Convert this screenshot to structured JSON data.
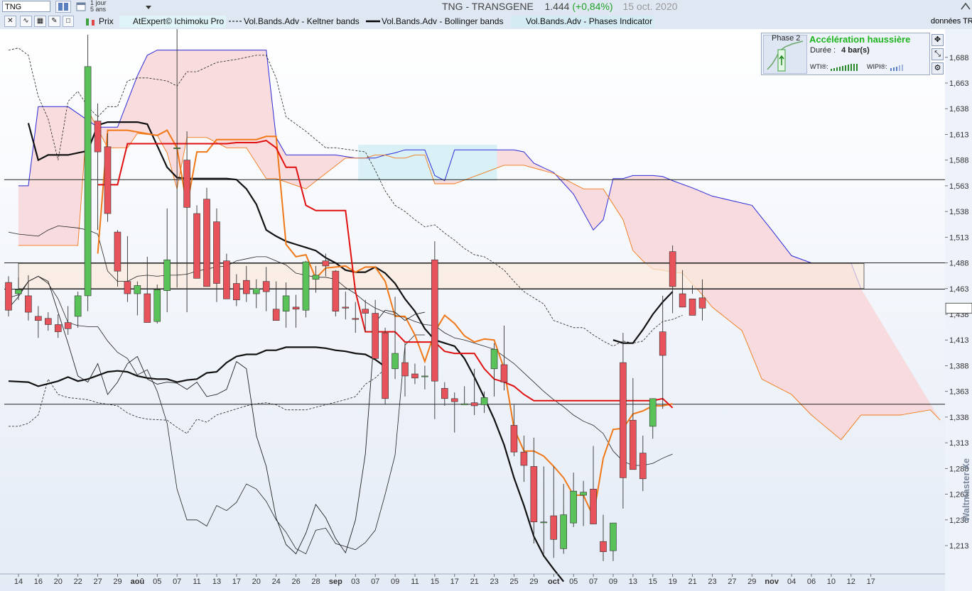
{
  "header": {
    "symbol": "TNG",
    "period_line1": "1 jour",
    "period_line2": "5 ans",
    "title_name": "TNG - TRANSGENE",
    "title_price": "1.444",
    "title_change": "(+0,84%)",
    "title_date": "15 oct. 2020",
    "donnees": "données TR"
  },
  "legend": {
    "prix": "Prix",
    "ichimoku": "AtExpert© Ichimoku Pro",
    "keltner": "Vol.Bands.Adv - Keltner bands",
    "bollinger": "Vol.Bands.Adv - Bollinger bands",
    "phases": "Vol.Bands.Adv - Phases Indicator"
  },
  "phase_panel": {
    "phase": "Phase 2",
    "title": "Accélération haussière",
    "duree_label": "Durée :",
    "duree_value": "4 bar(s)",
    "wti": "WTI®:",
    "wipi": "WIPI®:"
  },
  "brand": "Waltmaster Xe",
  "colors": {
    "bull": "#59c359",
    "bear": "#e8525a",
    "kijun": "#e01010",
    "tenkan": "#f07818",
    "cloud_bear": "#f8d6d8",
    "cloud_bull": "#d8f0f6",
    "span_line": "#2a2ad8"
  },
  "chart_data": {
    "type": "candlestick",
    "ylim": [
      1.19,
      1.72
    ],
    "yticks": [
      "1,688",
      "1,663",
      "1,638",
      "1,613",
      "1,588",
      "1,563",
      "1,538",
      "1,513",
      "1,488",
      "1,463",
      "1,438",
      "1,413",
      "1,388",
      "1,363",
      "1,338",
      "1,313",
      "1,288",
      "1,263",
      "1,238",
      "1,213"
    ],
    "x_labels": [
      "14",
      "16",
      "20",
      "22",
      "27",
      "29",
      "aoû",
      "05",
      "07",
      "11",
      "13",
      "17",
      "20",
      "24",
      "26",
      "28",
      "sep",
      "03",
      "07",
      "09",
      "11",
      "15",
      "17",
      "21",
      "23",
      "25",
      "29",
      "oct",
      "05",
      "07",
      "09",
      "13",
      "15",
      "19",
      "21",
      "23",
      "27",
      "29",
      "nov",
      "04",
      "06",
      "10",
      "12",
      "17"
    ],
    "current_price": 1.444,
    "horizontal_lines": [
      1.569,
      1.488,
      1.4625,
      1.3505
    ],
    "candles": [
      [
        1.469,
        1.475,
        1.436,
        1.442
      ],
      [
        1.458,
        1.474,
        1.452,
        1.462
      ],
      [
        1.456,
        1.476,
        1.432,
        1.44
      ],
      [
        1.436,
        1.446,
        1.415,
        1.432
      ],
      [
        1.434,
        1.44,
        1.422,
        1.428
      ],
      [
        1.428,
        1.438,
        1.415,
        1.421
      ],
      [
        1.43,
        1.446,
        1.418,
        1.424
      ],
      [
        1.436,
        1.46,
        1.425,
        1.456
      ],
      [
        1.456,
        1.71,
        1.441,
        1.679
      ],
      [
        1.626,
        1.643,
        1.52,
        1.596
      ],
      [
        1.601,
        1.614,
        1.528,
        1.536
      ],
      [
        1.518,
        1.52,
        1.465,
        1.48
      ],
      [
        1.47,
        1.514,
        1.45,
        1.458
      ],
      [
        1.458,
        1.47,
        1.437,
        1.466
      ],
      [
        1.458,
        1.494,
        1.437,
        1.43
      ],
      [
        1.431,
        1.467,
        1.429,
        1.462
      ],
      [
        1.461,
        1.541,
        1.44,
        1.491
      ],
      [
        1.599,
        1.749,
        1.464,
        1.6
      ],
      [
        1.588,
        1.616,
        1.44,
        1.542
      ],
      [
        1.536,
        1.544,
        1.478,
        1.473
      ],
      [
        1.55,
        1.561,
        1.508,
        1.465
      ],
      [
        1.528,
        1.541,
        1.45,
        1.468
      ],
      [
        1.49,
        1.497,
        1.455,
        1.453
      ],
      [
        1.468,
        1.477,
        1.446,
        1.452
      ],
      [
        1.471,
        1.485,
        1.45,
        1.458
      ],
      [
        1.458,
        1.472,
        1.444,
        1.463
      ],
      [
        1.47,
        1.484,
        1.441,
        1.46
      ],
      [
        1.443,
        1.47,
        1.432,
        1.432
      ],
      [
        1.441,
        1.469,
        1.425,
        1.456
      ],
      [
        1.445,
        1.457,
        1.425,
        1.443
      ],
      [
        1.442,
        1.49,
        1.435,
        1.489
      ],
      [
        1.472,
        1.485,
        1.459,
        1.476
      ],
      [
        1.49,
        1.497,
        1.475,
        1.485
      ],
      [
        1.48,
        1.481,
        1.436,
        1.441
      ],
      [
        1.445,
        1.46,
        1.433,
        1.444
      ],
      [
        1.434,
        1.45,
        1.42,
        1.433
      ],
      [
        1.443,
        1.452,
        1.421,
        1.439
      ],
      [
        1.439,
        1.452,
        1.405,
        1.395
      ],
      [
        1.42,
        1.425,
        1.35,
        1.356
      ],
      [
        1.385,
        1.455,
        1.375,
        1.4
      ],
      [
        1.391,
        1.41,
        1.358,
        1.378
      ],
      [
        1.38,
        1.39,
        1.37,
        1.376
      ],
      [
        1.378,
        1.388,
        1.365,
        1.378
      ],
      [
        1.491,
        1.509,
        1.336,
        1.373
      ],
      [
        1.366,
        1.372,
        1.349,
        1.356
      ],
      [
        1.356,
        1.362,
        1.323,
        1.353
      ],
      [
        1.35,
        1.368,
        1.35,
        1.351
      ],
      [
        1.352,
        1.385,
        1.34,
        1.349
      ],
      [
        1.35,
        1.363,
        1.342,
        1.357
      ],
      [
        1.385,
        1.41,
        1.358,
        1.404
      ],
      [
        1.389,
        1.427,
        1.364,
        1.372
      ],
      [
        1.33,
        1.35,
        1.3,
        1.304
      ],
      [
        1.304,
        1.32,
        1.275,
        1.291
      ],
      [
        1.29,
        1.318,
        1.215,
        1.236
      ],
      [
        1.236,
        1.29,
        1.205,
        1.236
      ],
      [
        1.242,
        1.29,
        1.201,
        1.219
      ],
      [
        1.21,
        1.273,
        1.205,
        1.243
      ],
      [
        1.235,
        1.284,
        1.231,
        1.266
      ],
      [
        1.262,
        1.276,
        1.232,
        1.265
      ],
      [
        1.268,
        1.31,
        1.255,
        1.234
      ],
      [
        1.217,
        1.243,
        1.198,
        1.207
      ],
      [
        1.208,
        1.229,
        1.198,
        1.235
      ],
      [
        1.391,
        1.42,
        1.249,
        1.279
      ],
      [
        1.335,
        1.376,
        1.29,
        1.287
      ],
      [
        1.303,
        1.32,
        1.266,
        1.278
      ],
      [
        1.329,
        1.342,
        1.317,
        1.356
      ],
      [
        1.421,
        1.456,
        1.346,
        1.398
      ],
      [
        1.499,
        1.505,
        1.439,
        1.465
      ],
      [
        1.458,
        1.481,
        1.456,
        1.445
      ],
      [
        1.453,
        1.466,
        1.458,
        1.437
      ],
      [
        1.454,
        1.472,
        1.432,
        1.444
      ]
    ],
    "tenkan": [
      [
        9,
        1.497
      ],
      [
        10,
        1.617
      ],
      [
        11,
        1.617
      ],
      [
        12,
        1.617
      ],
      [
        15,
        1.612
      ],
      [
        16,
        1.617
      ],
      [
        17,
        1.6
      ],
      [
        18,
        1.543
      ],
      [
        19,
        1.596
      ],
      [
        20,
        1.596
      ],
      [
        21,
        1.608
      ],
      [
        22,
        1.608
      ],
      [
        25,
        1.608
      ],
      [
        26,
        1.611
      ],
      [
        27,
        1.611
      ],
      [
        28,
        1.506
      ],
      [
        29,
        1.494
      ],
      [
        30,
        1.496
      ],
      [
        31,
        1.473
      ],
      [
        32,
        1.483
      ],
      [
        33,
        1.484
      ],
      [
        34,
        1.485
      ],
      [
        35,
        1.479
      ],
      [
        36,
        1.484
      ],
      [
        37,
        1.484
      ],
      [
        38,
        1.47
      ],
      [
        39,
        1.436
      ],
      [
        40,
        1.436
      ],
      [
        41,
        1.418
      ],
      [
        42,
        1.392
      ],
      [
        43,
        1.421
      ],
      [
        44,
        1.437
      ],
      [
        45,
        1.429
      ],
      [
        46,
        1.417
      ],
      [
        47,
        1.411
      ],
      [
        48,
        1.414
      ],
      [
        49,
        1.413
      ],
      [
        50,
        1.385
      ],
      [
        51,
        1.327
      ],
      [
        52,
        1.305
      ],
      [
        53,
        1.305
      ],
      [
        54,
        1.3
      ],
      [
        55,
        1.29
      ],
      [
        56,
        1.279
      ],
      [
        57,
        1.262
      ],
      [
        58,
        1.262
      ],
      [
        59,
        1.241
      ],
      [
        60,
        1.298
      ],
      [
        61,
        1.326
      ],
      [
        62,
        1.327
      ],
      [
        63,
        1.341
      ],
      [
        64,
        1.344
      ],
      [
        65,
        1.349
      ],
      [
        66,
        1.349
      ],
      [
        67,
        1.351
      ]
    ],
    "kijun": [
      [
        9,
        1.564
      ],
      [
        10,
        1.564
      ],
      [
        11,
        1.564
      ],
      [
        12,
        1.604
      ],
      [
        13,
        1.604
      ],
      [
        14,
        1.604
      ],
      [
        15,
        1.604
      ],
      [
        16,
        1.604
      ],
      [
        17,
        1.604
      ],
      [
        18,
        1.604
      ],
      [
        19,
        1.604
      ],
      [
        20,
        1.604
      ],
      [
        21,
        1.604
      ],
      [
        22,
        1.604
      ],
      [
        23,
        1.605
      ],
      [
        24,
        1.605
      ],
      [
        25,
        1.605
      ],
      [
        26,
        1.607
      ],
      [
        27,
        1.6
      ],
      [
        28,
        1.581
      ],
      [
        29,
        1.581
      ],
      [
        30,
        1.544
      ],
      [
        31,
        1.539
      ],
      [
        32,
        1.539
      ],
      [
        33,
        1.539
      ],
      [
        34,
        1.539
      ],
      [
        35,
        1.46
      ],
      [
        36,
        1.421
      ],
      [
        37,
        1.421
      ],
      [
        38,
        1.421
      ],
      [
        39,
        1.421
      ],
      [
        40,
        1.411
      ],
      [
        41,
        1.411
      ],
      [
        42,
        1.411
      ],
      [
        43,
        1.411
      ],
      [
        44,
        1.402
      ],
      [
        45,
        1.4
      ],
      [
        46,
        1.4
      ],
      [
        47,
        1.4
      ],
      [
        48,
        1.385
      ],
      [
        49,
        1.375
      ],
      [
        50,
        1.372
      ],
      [
        51,
        1.368
      ],
      [
        52,
        1.36
      ],
      [
        53,
        1.354
      ],
      [
        54,
        1.354
      ],
      [
        55,
        1.354
      ],
      [
        56,
        1.354
      ],
      [
        57,
        1.354
      ],
      [
        58,
        1.354
      ],
      [
        59,
        1.354
      ],
      [
        60,
        1.354
      ],
      [
        61,
        1.354
      ],
      [
        62,
        1.354
      ],
      [
        63,
        1.354
      ],
      [
        64,
        1.354
      ],
      [
        65,
        1.354
      ],
      [
        66,
        1.356
      ],
      [
        67,
        1.347
      ]
    ],
    "bollinger_mid": [
      [
        0,
        1.373
      ],
      [
        2,
        1.372
      ],
      [
        3,
        1.368
      ],
      [
        5,
        1.373
      ],
      [
        6,
        1.377
      ],
      [
        7,
        1.373
      ],
      [
        8,
        1.375
      ],
      [
        10,
        1.382
      ],
      [
        11,
        1.383
      ],
      [
        12,
        1.382
      ],
      [
        13,
        1.378
      ],
      [
        14,
        1.376
      ],
      [
        15,
        1.375
      ],
      [
        16,
        1.375
      ],
      [
        17,
        1.372
      ],
      [
        18,
        1.374
      ],
      [
        19,
        1.375
      ],
      [
        20,
        1.381
      ],
      [
        21,
        1.382
      ],
      [
        22,
        1.391
      ],
      [
        23,
        1.397
      ],
      [
        24,
        1.399
      ],
      [
        25,
        1.399
      ],
      [
        26,
        1.403
      ],
      [
        27,
        1.403
      ],
      [
        28,
        1.406
      ],
      [
        29,
        1.406
      ],
      [
        30,
        1.406
      ],
      [
        31,
        1.406
      ],
      [
        32,
        1.405
      ],
      [
        33,
        1.403
      ],
      [
        34,
        1.402
      ],
      [
        35,
        1.4
      ],
      [
        36,
        1.399
      ],
      [
        37,
        1.394
      ],
      [
        38,
        1.387
      ]
    ],
    "bollinger_fast": [
      [
        2,
        1.624
      ],
      [
        3,
        1.588
      ],
      [
        4,
        1.593
      ],
      [
        6,
        1.593
      ],
      [
        8,
        1.597
      ],
      [
        9,
        1.622
      ],
      [
        10,
        1.625
      ],
      [
        11,
        1.625
      ],
      [
        12,
        1.625
      ],
      [
        13,
        1.625
      ],
      [
        14,
        1.623
      ],
      [
        15,
        1.602
      ],
      [
        16,
        1.581
      ],
      [
        17,
        1.571
      ],
      [
        18,
        1.57
      ],
      [
        19,
        1.57
      ],
      [
        20,
        1.57
      ],
      [
        21,
        1.57
      ],
      [
        22,
        1.57
      ],
      [
        23,
        1.569
      ],
      [
        24,
        1.56
      ],
      [
        25,
        1.545
      ],
      [
        26,
        1.52
      ],
      [
        27,
        1.514
      ],
      [
        28,
        1.509
      ],
      [
        29,
        1.506
      ],
      [
        30,
        1.503
      ],
      [
        31,
        1.5
      ],
      [
        32,
        1.493
      ],
      [
        33,
        1.488
      ],
      [
        34,
        1.481
      ],
      [
        35,
        1.479
      ],
      [
        36,
        1.479
      ],
      [
        37,
        1.484
      ],
      [
        38,
        1.478
      ],
      [
        39,
        1.468
      ],
      [
        40,
        1.453
      ],
      [
        41,
        1.441
      ],
      [
        42,
        1.424
      ],
      [
        43,
        1.413
      ],
      [
        44,
        1.41
      ],
      [
        45,
        1.407
      ],
      [
        46,
        1.395
      ],
      [
        47,
        1.377
      ],
      [
        48,
        1.357
      ],
      [
        49,
        1.336
      ],
      [
        50,
        1.311
      ],
      [
        51,
        1.279
      ],
      [
        52,
        1.252
      ],
      [
        53,
        1.222
      ],
      [
        54,
        1.203
      ],
      [
        55,
        1.19
      ],
      [
        56,
        1.178
      ]
    ],
    "bollinger_late": [
      [
        61,
        1.413
      ],
      [
        62,
        1.41
      ],
      [
        63,
        1.41
      ],
      [
        64,
        1.423
      ],
      [
        65,
        1.438
      ],
      [
        66,
        1.45
      ],
      [
        67,
        1.46
      ]
    ]
  }
}
